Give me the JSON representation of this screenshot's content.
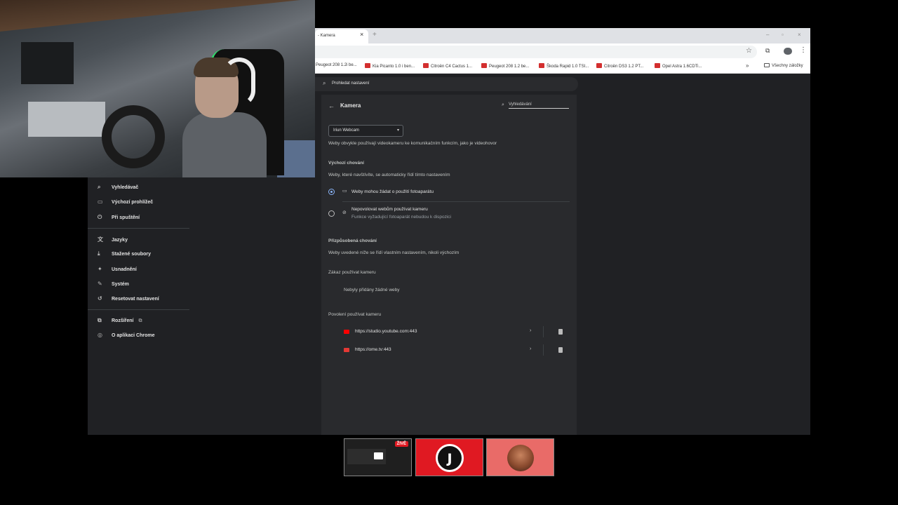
{
  "browser": {
    "tab_title": "- Kamera",
    "tab_close": "×",
    "new_tab": "+",
    "window_controls": [
      "–",
      "▫",
      "×"
    ],
    "bookmarks": [
      "Peugeot 208 1.2i be...",
      "Kia Picanto 1.0 i ben...",
      "Citroën C4 Cactus 1...",
      "Peugeot 208 1.2 be...",
      "Škoda Rapid 1.0 TSI...",
      "Citroën DS3 1.2 PT...",
      "Opel Astra 1.6CDTi..."
    ],
    "bookmarks_more": "»",
    "all_bookmarks": "Všechny záložky"
  },
  "settings": {
    "search_placeholder": "Prohledat nastavení",
    "sidebar": [
      {
        "icon": "search-icon",
        "glyph": "⌕",
        "label": "Vyhledávač"
      },
      {
        "icon": "browser-icon",
        "glyph": "▭",
        "label": "Výchozí prohlížeč"
      },
      {
        "icon": "power-icon",
        "glyph": "⏻",
        "label": "Při spuštění"
      },
      {
        "icon": "translate-icon",
        "glyph": "文",
        "label": "Jazyky"
      },
      {
        "icon": "download-icon",
        "glyph": "⤓",
        "label": "Stažené soubory"
      },
      {
        "icon": "accessibility-icon",
        "glyph": "✦",
        "label": "Usnadnění"
      },
      {
        "icon": "wrench-icon",
        "glyph": "✎",
        "label": "Systém"
      },
      {
        "icon": "reset-icon",
        "glyph": "↺",
        "label": "Resetovat nastavení"
      },
      {
        "icon": "puzzle-icon",
        "glyph": "⧉",
        "label": "Rozšíření"
      },
      {
        "icon": "chrome-icon",
        "glyph": "◎",
        "label": "O aplikaci Chrome"
      }
    ],
    "page_title": "Kamera",
    "card_search_placeholder": "Vyhledávání",
    "device": "Iriun Webcam",
    "device_caret": "▾",
    "intro": "Weby obvykle používají videokameru ke komunikačním funkcím, jako je videohovor",
    "default_heading": "Výchozí chování",
    "default_sub": "Weby, které navštívíte, se automaticky řídí tímto nastavením",
    "option_allow": "Weby mohou žádat o použití fotoaparátu",
    "option_block": "Nepovolovat webům používat kameru",
    "option_block_sub": "Funkce vyžadující fotoaparát nebudou k dispozici",
    "custom_heading": "Přizpůsobená chování",
    "custom_sub": "Weby uvedené níže se řídí vlastním nastavením, nikoli výchozím",
    "blocked_heading": "Zákaz používat kameru",
    "blocked_empty": "Nebyly přidány žádné weby",
    "allowed_heading": "Povolení používat kameru",
    "allowed_sites": [
      {
        "url": "https://studio.youtube.com:443",
        "color": "#ff0000"
      },
      {
        "url": "https://ome.tv:443",
        "color": "#e53935"
      }
    ]
  },
  "stream": {
    "live_badge": "ŽIVĚ",
    "j_letter": "J"
  }
}
